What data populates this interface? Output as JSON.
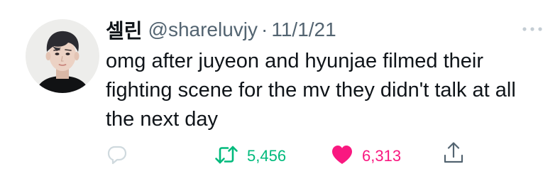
{
  "tweet": {
    "display_name": "셀린",
    "handle": "@shareluvjy",
    "separator": "·",
    "date": "11/1/21",
    "text": "omg after juyeon and hyunjae filmed their fighting scene for the mv they didn't talk at all the next day",
    "retweets": "5,456",
    "likes": "6,313"
  },
  "icons": {
    "avatar": "profile-photo",
    "more": "more-icon",
    "reply": "reply-icon",
    "retweet": "retweet-icon",
    "like": "heart-icon",
    "share": "share-icon"
  },
  "colors": {
    "text": "#0f1419",
    "secondary": "#536471",
    "retweet_active": "#00ba7c",
    "like_active": "#f91880",
    "reply_icon": "#cfd9de"
  }
}
